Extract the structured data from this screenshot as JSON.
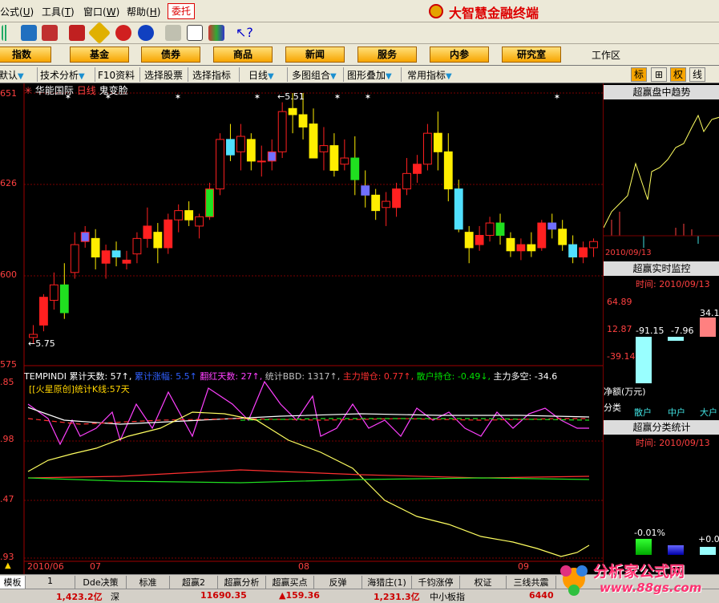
{
  "menus": [
    {
      "label": "公式",
      "key": "U"
    },
    {
      "label": "工具",
      "key": "T"
    },
    {
      "label": "窗口",
      "key": "W"
    },
    {
      "label": "帮助",
      "key": "H"
    }
  ],
  "weituo": "委托",
  "brand": "大智慧金融终端",
  "nav_buttons": [
    "指数",
    "基金",
    "债券",
    "商品",
    "新闻",
    "服务",
    "内参",
    "研究室"
  ],
  "workarea": "工作区",
  "tabs": [
    "默认",
    "技术分析",
    "F10资料",
    "选择股票",
    "选择指标",
    "日线",
    "多图组合",
    "图形叠加",
    "常用指标"
  ],
  "right_tabs": [
    "标",
    "⊞",
    "权",
    "线"
  ],
  "stock": {
    "name": "华能国际",
    "period": "日线",
    "tag": "鬼变脸"
  },
  "price_axis": [
    "651",
    "626",
    "600",
    "575"
  ],
  "price_high_label": "←5.51",
  "price_low_label": "←5.75",
  "indicator_axis": [
    ".85",
    ".98",
    ".47",
    ".93"
  ],
  "indicator_line1": [
    {
      "text": "TEMPINDI",
      "color": "#ffffff"
    },
    {
      "text": "累计天数: 57↑,",
      "color": "#ffffff"
    },
    {
      "text": "累计涨幅: 5.5↑",
      "color": "#3060ff"
    },
    {
      "text": "翻红天数: 27↑,",
      "color": "#ff40ff"
    },
    {
      "text": "统计BBD: 1317↑,",
      "color": "#c0c0c0"
    },
    {
      "text": "主力增仓: 0.77↑,",
      "color": "#ff3030"
    },
    {
      "text": "散户持仓: -0.49↓,",
      "color": "#00e000"
    },
    {
      "text": "主力多空: -34.6",
      "color": "#ffffff"
    }
  ],
  "indicator_line2": "[[火星原创]统计K线:57天",
  "date_axis": [
    "2010/06",
    "07",
    "08",
    "09"
  ],
  "right_panel": {
    "t1": "超赢盘中趋势",
    "d1": "2010/09/13",
    "t2": "超赢实时监控",
    "d2": "时间: 2010/09/13",
    "vals": [
      "64.89",
      "12.87",
      "-39.14"
    ],
    "bar_labels": [
      "-91.15",
      "-7.96",
      "34.1"
    ],
    "net": "净额(万元)",
    "cls": "分类",
    "groups": [
      "散户",
      "中户",
      "大户"
    ],
    "t3": "超赢分类统计",
    "d3": "时间: 2010/09/13",
    "pct1": "-0.01%",
    "pct2": "+0.0"
  },
  "bottom_tabs": [
    "模板",
    "1",
    "Dde决策",
    "标准",
    "超赢2",
    "超赢分析",
    "超赢买点",
    "反弹",
    "海猎庄(1)",
    "千钧涨停",
    "权证",
    "三线共震"
  ],
  "status": {
    "s1": "1,423.2亿",
    "s1b": "深",
    "s2": "11690.35",
    "s3": "▲159.36",
    "s4": "1,231.3亿",
    "s4b": "中小板指",
    "s5": "6440"
  },
  "watermark": {
    "title": "分析家公式网",
    "url": "www.88gs.com"
  },
  "chart_data": {
    "type": "candlestick",
    "candles": [
      [
        5.76,
        5.8,
        5.74,
        5.77
      ],
      [
        5.8,
        5.9,
        5.78,
        5.89
      ],
      [
        5.88,
        5.97,
        5.85,
        5.93
      ],
      [
        5.93,
        6.0,
        5.82,
        5.84
      ],
      [
        5.97,
        6.1,
        5.95,
        6.06
      ],
      [
        6.07,
        6.12,
        6.05,
        6.1
      ],
      [
        6.08,
        6.11,
        5.98,
        6.02
      ],
      [
        6.0,
        6.06,
        5.95,
        6.04
      ],
      [
        6.04,
        6.07,
        5.99,
        6.02
      ],
      [
        6.0,
        6.04,
        5.98,
        6.01
      ],
      [
        6.03,
        6.1,
        6.0,
        6.08
      ],
      [
        6.08,
        6.18,
        6.05,
        6.12
      ],
      [
        6.1,
        6.13,
        6.0,
        6.05
      ],
      [
        6.05,
        6.16,
        6.03,
        6.14
      ],
      [
        6.14,
        6.19,
        6.1,
        6.17
      ],
      [
        6.17,
        6.2,
        6.12,
        6.14
      ],
      [
        6.12,
        6.16,
        6.08,
        6.15
      ],
      [
        6.15,
        6.26,
        6.14,
        6.24
      ],
      [
        6.24,
        6.42,
        6.22,
        6.4
      ],
      [
        6.4,
        6.45,
        6.33,
        6.35
      ],
      [
        6.36,
        6.45,
        6.3,
        6.41
      ],
      [
        6.4,
        6.42,
        6.3,
        6.33
      ],
      [
        6.33,
        6.38,
        6.28,
        6.33
      ],
      [
        6.33,
        6.4,
        6.3,
        6.36
      ],
      [
        6.36,
        6.52,
        6.34,
        6.49
      ],
      [
        6.5,
        6.55,
        6.42,
        6.48
      ],
      [
        6.48,
        6.55,
        6.4,
        6.44
      ],
      [
        6.45,
        6.5,
        6.34,
        6.34
      ],
      [
        6.36,
        6.44,
        6.3,
        6.38
      ],
      [
        6.38,
        6.42,
        6.28,
        6.3
      ],
      [
        6.32,
        6.4,
        6.3,
        6.34
      ],
      [
        6.34,
        6.41,
        6.22,
        6.27
      ],
      [
        6.25,
        6.3,
        6.18,
        6.22
      ],
      [
        6.22,
        6.24,
        6.14,
        6.17
      ],
      [
        6.18,
        6.23,
        6.12,
        6.2
      ],
      [
        6.18,
        6.26,
        6.15,
        6.24
      ],
      [
        6.24,
        6.34,
        6.22,
        6.29
      ],
      [
        6.29,
        6.35,
        6.26,
        6.32
      ],
      [
        6.32,
        6.45,
        6.3,
        6.42
      ],
      [
        6.42,
        6.49,
        6.3,
        6.36
      ],
      [
        6.36,
        6.42,
        6.2,
        6.24
      ],
      [
        6.24,
        6.27,
        6.1,
        6.11
      ],
      [
        6.1,
        6.12,
        6.0,
        6.05
      ],
      [
        6.06,
        6.12,
        6.04,
        6.09
      ],
      [
        6.09,
        6.15,
        6.07,
        6.13
      ],
      [
        6.13,
        6.16,
        6.06,
        6.09
      ],
      [
        6.08,
        6.1,
        6.02,
        6.04
      ],
      [
        6.04,
        6.08,
        6.01,
        6.06
      ],
      [
        6.06,
        6.1,
        6.02,
        6.04
      ],
      [
        6.05,
        6.14,
        6.04,
        6.13
      ],
      [
        6.13,
        6.16,
        6.08,
        6.11
      ],
      [
        6.11,
        6.14,
        6.04,
        6.06
      ],
      [
        6.06,
        6.09,
        6.0,
        6.02
      ],
      [
        6.02,
        6.07,
        6.0,
        6.05
      ],
      [
        6.05,
        6.08,
        6.02,
        6.07
      ]
    ],
    "y_min": 5.7,
    "y_max": 6.55
  }
}
